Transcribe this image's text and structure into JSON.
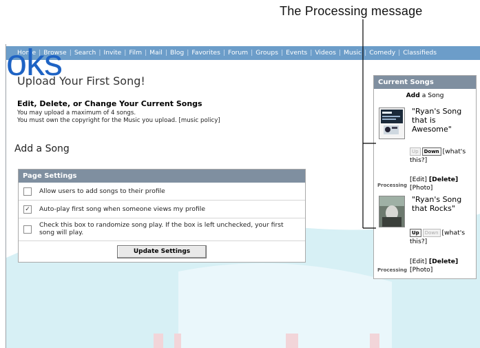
{
  "callout": {
    "label": "The Processing message"
  },
  "logo_overlay": "oks",
  "nav": {
    "items": [
      "Home",
      "Browse",
      "Search",
      "Invite",
      "Film",
      "Mail",
      "Blog",
      "Favorites",
      "Forum",
      "Groups",
      "Events",
      "Videos",
      "Music",
      "Comedy",
      "Classifieds"
    ]
  },
  "page": {
    "title": "Upload Your First Song!",
    "manage_heading": "Edit, Delete, or Change Your Current Songs",
    "max_songs_text": "You may upload a maximum of 4 songs.",
    "copyright_text": "You must own the copyright for the Music you upload.",
    "music_policy_link": "[music policy]",
    "add_song_heading": "Add a Song"
  },
  "settings": {
    "header": "Page Settings",
    "options": [
      {
        "text": "Allow users to add songs to their profile",
        "checked": false
      },
      {
        "text": "Auto-play first song when someone views my profile",
        "checked": true
      },
      {
        "text": "Check this box to randomize song play. If the box is left unchecked, your first song will play.",
        "checked": false
      }
    ],
    "update_button": "Update Settings"
  },
  "current_songs": {
    "header": "Current Songs",
    "add_bold": "Add",
    "add_rest": " a Song",
    "songs": [
      {
        "title": "\"Ryan's Song that is Awesome\"",
        "status": "Processing",
        "up_label": "Up",
        "down_label": "Down",
        "up_enabled": false,
        "down_enabled": true,
        "whats_this": "[what's this?]",
        "edit": "[Edit]",
        "delete": "[Delete]",
        "photo": "[Photo]"
      },
      {
        "title": "\"Ryan's Song that Rocks\"",
        "status": "Processing",
        "up_label": "Up",
        "down_label": "Down",
        "up_enabled": true,
        "down_enabled": false,
        "whats_this": "[what's this?]",
        "edit": "[Edit]",
        "delete": "[Delete]",
        "photo": "[Photo]"
      }
    ]
  },
  "colors": {
    "navbar": "#6c9dc9",
    "panel_header": "#7f8fa0",
    "logo_blue": "#1e63c4",
    "background_cyan": "#d7f0f5"
  }
}
